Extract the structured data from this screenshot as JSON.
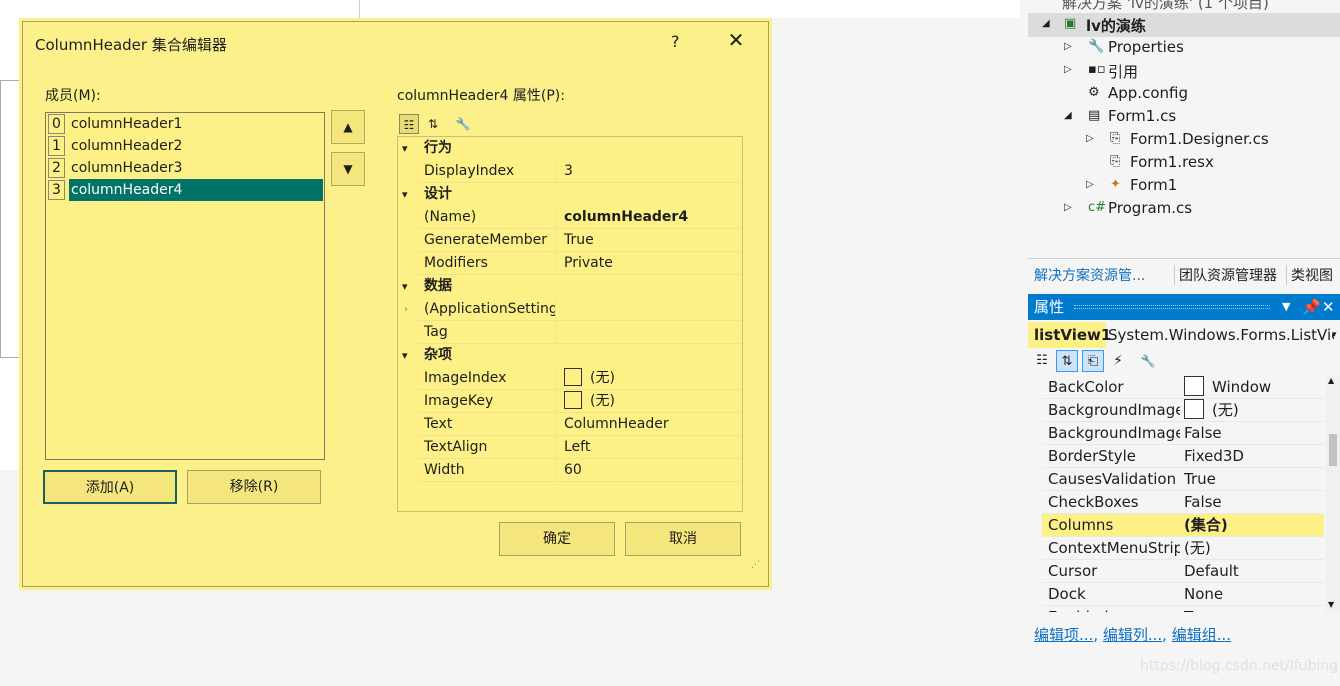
{
  "dialog": {
    "title": "ColumnHeader 集合编辑器",
    "help": "?",
    "close": "✕",
    "members_label": "成员(M):",
    "members": [
      {
        "index": "0",
        "name": "columnHeader1"
      },
      {
        "index": "1",
        "name": "columnHeader2"
      },
      {
        "index": "2",
        "name": "columnHeader3"
      },
      {
        "index": "3",
        "name": "columnHeader4"
      }
    ],
    "up": "🡅",
    "down": "🡇",
    "add_label": "添加(A)",
    "remove_label": "移除(R)",
    "props_label": "columnHeader4 属性(P):",
    "categories": {
      "behavior": "行为",
      "design": "设计",
      "data": "数据",
      "misc": "杂项"
    },
    "properties": {
      "display_index": {
        "key": "DisplayIndex",
        "value": "3"
      },
      "name": {
        "key": "(Name)",
        "value": "columnHeader4"
      },
      "generate_member": {
        "key": "GenerateMember",
        "value": "True"
      },
      "modifiers": {
        "key": "Modifiers",
        "value": "Private"
      },
      "app_settings": {
        "key": "(ApplicationSettings)",
        "value": ""
      },
      "tag": {
        "key": "Tag",
        "value": ""
      },
      "image_index": {
        "key": "ImageIndex",
        "value": "(无)"
      },
      "image_key": {
        "key": "ImageKey",
        "value": "(无)"
      },
      "text": {
        "key": "Text",
        "value": "ColumnHeader"
      },
      "text_align": {
        "key": "TextAlign",
        "value": "Left"
      },
      "width": {
        "key": "Width",
        "value": "60"
      }
    },
    "ok_label": "确定",
    "cancel_label": "取消"
  },
  "solution": {
    "header_partial": "解决方案 'lv的演练' (1 个项目)",
    "project": "lv的演练",
    "items": {
      "properties": "Properties",
      "refs": "引用",
      "appconfig": "App.config",
      "form1cs": "Form1.cs",
      "designer": "Form1.Designer.cs",
      "resx": "Form1.resx",
      "form1": "Form1",
      "program": "Program.cs"
    },
    "tabs": [
      "解决方案资源管...",
      "团队资源管理器",
      "类视图"
    ]
  },
  "properties_panel": {
    "title": "属性",
    "object_name": "listView1",
    "object_type": "System.Windows.Forms.ListVie",
    "rows": [
      {
        "key": "BackColor",
        "value": "Window",
        "swatch": true
      },
      {
        "key": "BackgroundImage",
        "value": "(无)",
        "swatch": true
      },
      {
        "key": "BackgroundImageLayout",
        "value": "False"
      },
      {
        "key": "BorderStyle",
        "value": "Fixed3D"
      },
      {
        "key": "CausesValidation",
        "value": "True"
      },
      {
        "key": "CheckBoxes",
        "value": "False"
      },
      {
        "key": "Columns",
        "value": "(集合)",
        "highlight": true
      },
      {
        "key": "ContextMenuStrip",
        "value": "(无)"
      },
      {
        "key": "Cursor",
        "value": "Default"
      },
      {
        "key": "Dock",
        "value": "None"
      },
      {
        "key": "Enabled",
        "value": "True"
      }
    ],
    "links": [
      "编辑项...",
      "编辑列...",
      "编辑组..."
    ]
  },
  "watermark": "https://blog.csdn.net/lfubing",
  "colors": {
    "dialog_bg": "#fcf087",
    "selection": "#007366",
    "accent": "#007acc"
  }
}
